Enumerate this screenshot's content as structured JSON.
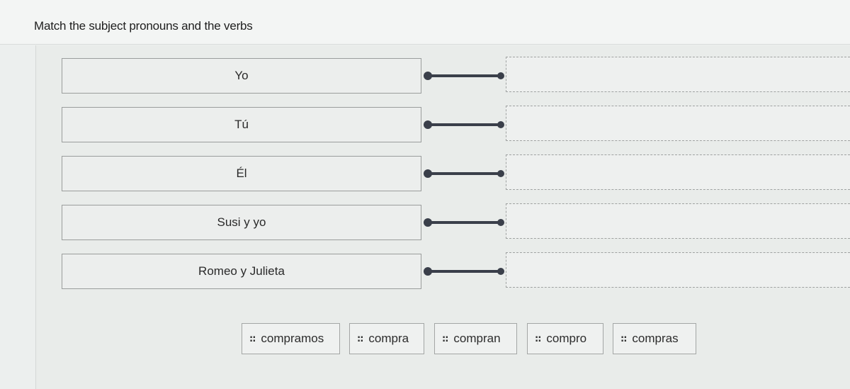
{
  "instruction": "Match the subject pronouns and the verbs",
  "prompts": [
    {
      "label": "Yo"
    },
    {
      "label": "Tú"
    },
    {
      "label": "Él"
    },
    {
      "label": "Susi y yo"
    },
    {
      "label": "Romeo y Julieta"
    }
  ],
  "options": [
    {
      "label": "compramos",
      "icon": "drag-handle-icon",
      "grip": "::"
    },
    {
      "label": "compra",
      "icon": "drag-handle-icon",
      "grip": "::"
    },
    {
      "label": "compran",
      "icon": "drag-handle-icon",
      "grip": "::"
    },
    {
      "label": "compro",
      "icon": "drag-handle-icon",
      "grip": "::"
    },
    {
      "label": "compras",
      "icon": "drag-handle-icon",
      "grip": "::"
    }
  ],
  "colors": {
    "connector": "#3a3f4a",
    "background": "#ecefee",
    "border": "#9a9d9c"
  }
}
